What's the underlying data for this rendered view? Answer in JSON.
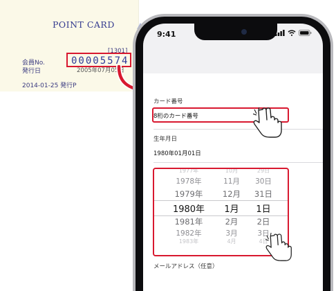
{
  "card": {
    "title": "POINT CARD",
    "bracket_code": "[1301]",
    "member_label": "会員No.",
    "member_number": "00005574",
    "issue_label": "発行日",
    "issue_date": "2005年07月05日",
    "footer": "2014-01-25  発行P"
  },
  "phone": {
    "status_time": "9:41",
    "icons": [
      "signal-icon",
      "wifi-icon",
      "battery-icon"
    ]
  },
  "form": {
    "card_number_label": "カード番号",
    "card_number_placeholder": "8桁のカード番号",
    "birthdate_label": "生年月日",
    "birthdate_value": "1980年01月01日",
    "email_label": "メールアドレス（任意）"
  },
  "picker": {
    "rows": [
      {
        "year": "1977年",
        "month": "10月",
        "day": "29日"
      },
      {
        "year": "1978年",
        "month": "11月",
        "day": "30日"
      },
      {
        "year": "1979年",
        "month": "12月",
        "day": "31日"
      },
      {
        "year": "1980年",
        "month": "1月",
        "day": "1日"
      },
      {
        "year": "1981年",
        "month": "2月",
        "day": "2日"
      },
      {
        "year": "1982年",
        "month": "3月",
        "day": "3日"
      },
      {
        "year": "1983年",
        "month": "4月",
        "day": "4日"
      }
    ],
    "selected_index": 3
  },
  "colors": {
    "highlight": "#d8182f",
    "card_ink": "#343b8f",
    "card_background": "#fbf9e8"
  }
}
